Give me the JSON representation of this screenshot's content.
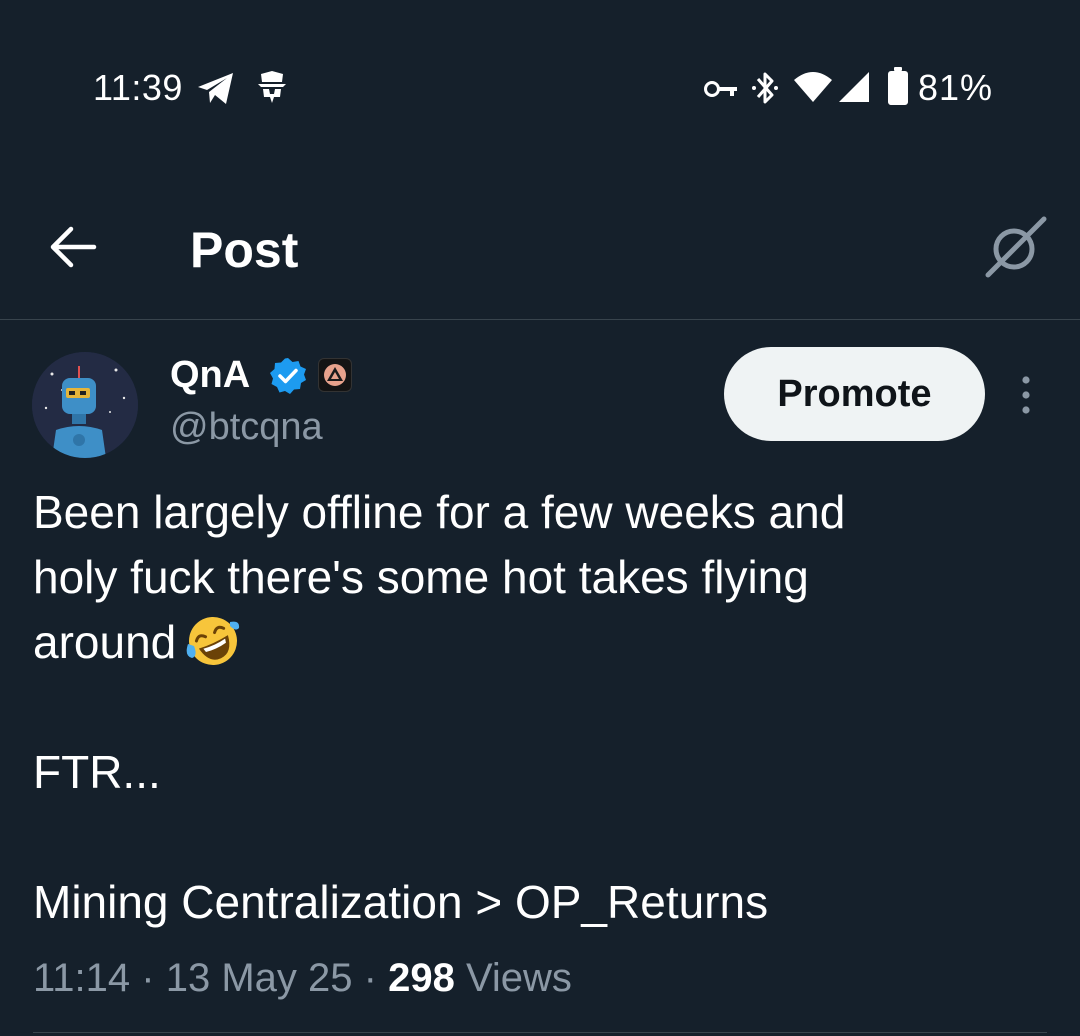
{
  "status_bar": {
    "time": "11:39",
    "battery": "81%",
    "icons": [
      "telegram-icon",
      "incognito-icon",
      "key-icon",
      "bluetooth-icon",
      "wifi-icon",
      "signal-icon",
      "battery-icon"
    ]
  },
  "header": {
    "title": "Post",
    "back_icon": "arrow-left-icon",
    "grok_icon": "grok-icon"
  },
  "post": {
    "author": {
      "display_name": "QnA",
      "handle": "@btcqna",
      "verified": true,
      "verified_color": "#1d9bf0"
    },
    "promote_label": "Promote",
    "text_lines": [
      "Been largely offline for a few weeks and",
      "holy fuck there's some hot takes flying",
      "around",
      "",
      "FTR...",
      "",
      "Mining Centralization > OP_Returns"
    ],
    "emoji": "rolling-on-floor-laughing-emoji",
    "time": "11:14",
    "date": "13 May 25",
    "views_count": "298",
    "views_label": "Views"
  },
  "colors": {
    "background": "#15202b",
    "text": "#ffffff",
    "secondary_text": "#8b98a5",
    "divider": "#38444d",
    "button_bg": "#eff3f4",
    "button_text": "#0f1419"
  }
}
